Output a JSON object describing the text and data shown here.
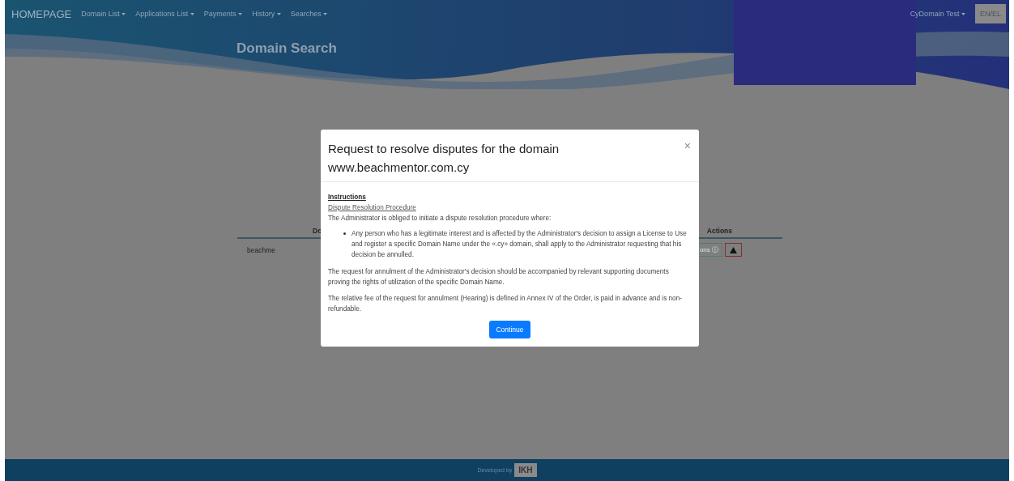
{
  "nav": {
    "brand": "HOMEPAGE",
    "menus": [
      {
        "label": "Domain List"
      },
      {
        "label": "Applications List"
      },
      {
        "label": "Payments"
      },
      {
        "label": "History"
      },
      {
        "label": "Searches"
      }
    ],
    "user": "CyDomain Test",
    "language": "EN/EL"
  },
  "banner": {
    "title": "Domain Search"
  },
  "table": {
    "columns": [
      "Do",
      "Actions"
    ],
    "rows": [
      {
        "domain": "beachme",
        "action": "ons ⓘ"
      }
    ]
  },
  "modal": {
    "title": "Request to resolve disputes for the domain www.beachmentor.com.cy",
    "close": "×",
    "heading": "Instructions",
    "link": "Dispute Resolution Procedure",
    "intro": "The Administrator is obliged to initiate a dispute resolution procedure where:",
    "bullets": [
      "Any person who has a legitimate interest and is affected by the Administrator's decision to assign a License to Use and register a specific Domain Name under the «.cy» domain, shall apply to the Administrator requesting that his decision be annulled."
    ],
    "paragraphs": [
      "The request for annulment of the Administrator's decision should be accompanied by relevant supporting documents proving the rights of utilization of the specific Domain Name.",
      "The relative fee of the request for annulment (Hearing) is defined in Annex IV of the Order, is paid in advance and is non-refundable."
    ],
    "button": "Continue"
  },
  "footer": {
    "text": "Developed by",
    "logo": "IKH"
  }
}
